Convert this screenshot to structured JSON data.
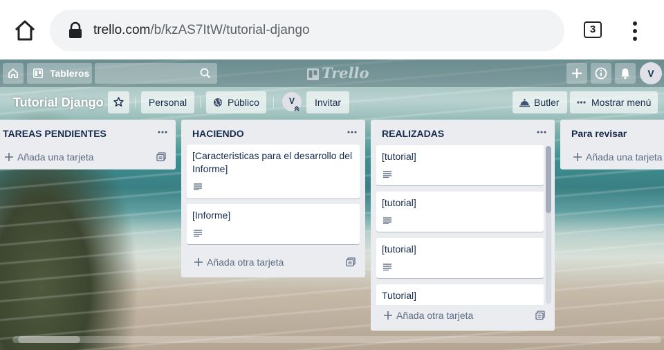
{
  "browser": {
    "url_domain": "trello.com",
    "url_path": "/b/kzAS7ItW/tutorial-django",
    "tab_count": "3"
  },
  "topbar": {
    "boards_label": "Tableros",
    "logo_text": "Trello",
    "avatar_initial": "V"
  },
  "board_header": {
    "title": "Tutorial Django",
    "personal_label": "Personal",
    "visibility_label": "Público",
    "member_initial": "V",
    "invite_label": "Invitar",
    "butler_label": "Butler",
    "menu_label": "Mostrar menú"
  },
  "lists": [
    {
      "title": "TAREAS PENDIENTES",
      "cards": [],
      "add_label": "Añada una tarjeta"
    },
    {
      "title": "HACIENDO",
      "cards": [
        {
          "title": "[Caracteristicas para el desarrollo del Informe]",
          "has_description": true
        },
        {
          "title": "[Informe]",
          "has_description": true
        }
      ],
      "add_label": "Añada otra tarjeta"
    },
    {
      "title": "REALIZADAS",
      "cards": [
        {
          "title": "[tutorial]",
          "has_description": true
        },
        {
          "title": "[tutorial]",
          "has_description": true
        },
        {
          "title": "[tutorial]",
          "has_description": true
        },
        {
          "title": "Tutorial]",
          "has_description": false
        }
      ],
      "add_label": "Añada otra tarjeta"
    },
    {
      "title": "Para revisar",
      "cards": [],
      "add_label": "Añada una tarjeta"
    }
  ],
  "colors": {
    "list_bg": "#ebecf0",
    "text_dark": "#172b4d",
    "text_muted": "#5e6c84"
  }
}
